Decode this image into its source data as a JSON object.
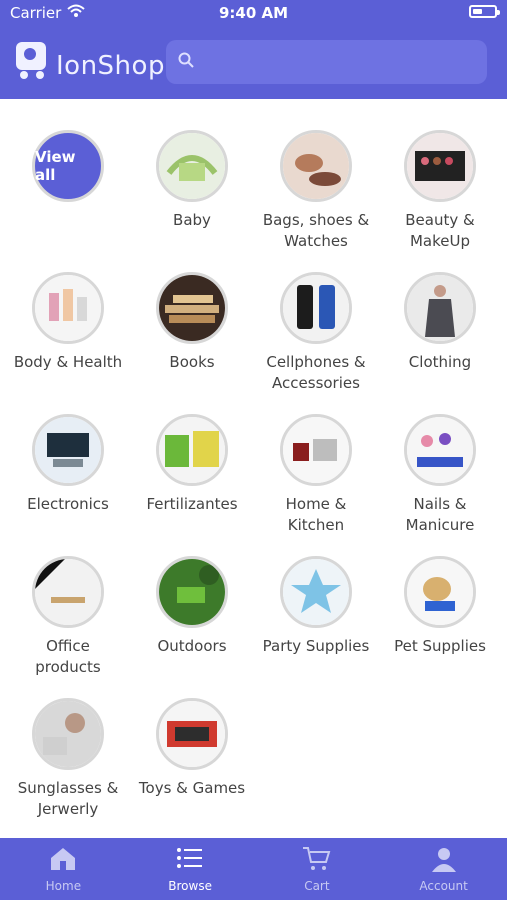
{
  "status": {
    "carrier": "Carrier",
    "time": "9:40 AM"
  },
  "header": {
    "brand": "IonShop",
    "search_placeholder": ""
  },
  "colors": {
    "primary": "#5b5fd6",
    "search": "#6e72e2",
    "text": "#444444"
  },
  "categories": [
    {
      "label": "View all",
      "icon": "view-all"
    },
    {
      "label": "Baby",
      "icon": "baby-product-image"
    },
    {
      "label": "Bags, shoes &\nWatches",
      "icon": "bags-image"
    },
    {
      "label": "Beauty &\nMakeUp",
      "icon": "makeup-image"
    },
    {
      "label": "Body & Health",
      "icon": "body-health-image"
    },
    {
      "label": "Books",
      "icon": "books-image"
    },
    {
      "label": "Cellphones &\nAccessories",
      "icon": "phones-image"
    },
    {
      "label": "Clothing",
      "icon": "clothing-image"
    },
    {
      "label": "Electronics",
      "icon": "electronics-image"
    },
    {
      "label": "Fertilizantes",
      "icon": "fertilizer-image"
    },
    {
      "label": "Home &\nKitchen",
      "icon": "kitchen-image"
    },
    {
      "label": "Nails &\nManicure",
      "icon": "nails-image"
    },
    {
      "label": "Office\nproducts",
      "icon": "office-image"
    },
    {
      "label": "Outdoors",
      "icon": "outdoors-image"
    },
    {
      "label": "Party Supplies",
      "icon": "party-image"
    },
    {
      "label": "Pet Supplies",
      "icon": "pet-image"
    },
    {
      "label": "Sunglasses &\nJerwerly",
      "icon": "sunglasses-image"
    },
    {
      "label": "Toys & Games",
      "icon": "toys-image"
    }
  ],
  "tabs": [
    {
      "label": "Home",
      "icon": "home-icon"
    },
    {
      "label": "Browse",
      "icon": "list-icon",
      "active": true
    },
    {
      "label": "Cart",
      "icon": "cart-icon"
    },
    {
      "label": "Account",
      "icon": "user-icon"
    }
  ]
}
